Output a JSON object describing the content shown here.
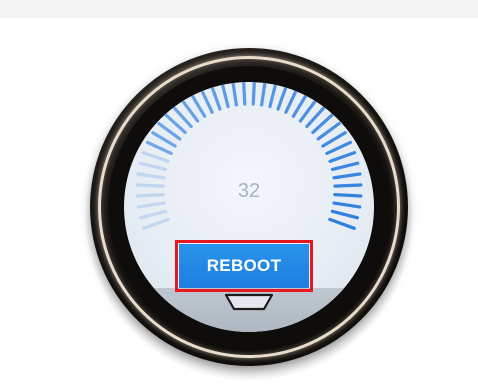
{
  "gauge": {
    "value": "32",
    "reboot_label": "REBOOT",
    "tick_count": 40,
    "colors": {
      "tick_active": "#2f7fe0",
      "tick_fade": "#a9c6ee",
      "button": "#1d7fde",
      "highlight_outline": "#e5181f"
    }
  },
  "icons": {
    "nav_tab": "chevron-tab-icon"
  }
}
